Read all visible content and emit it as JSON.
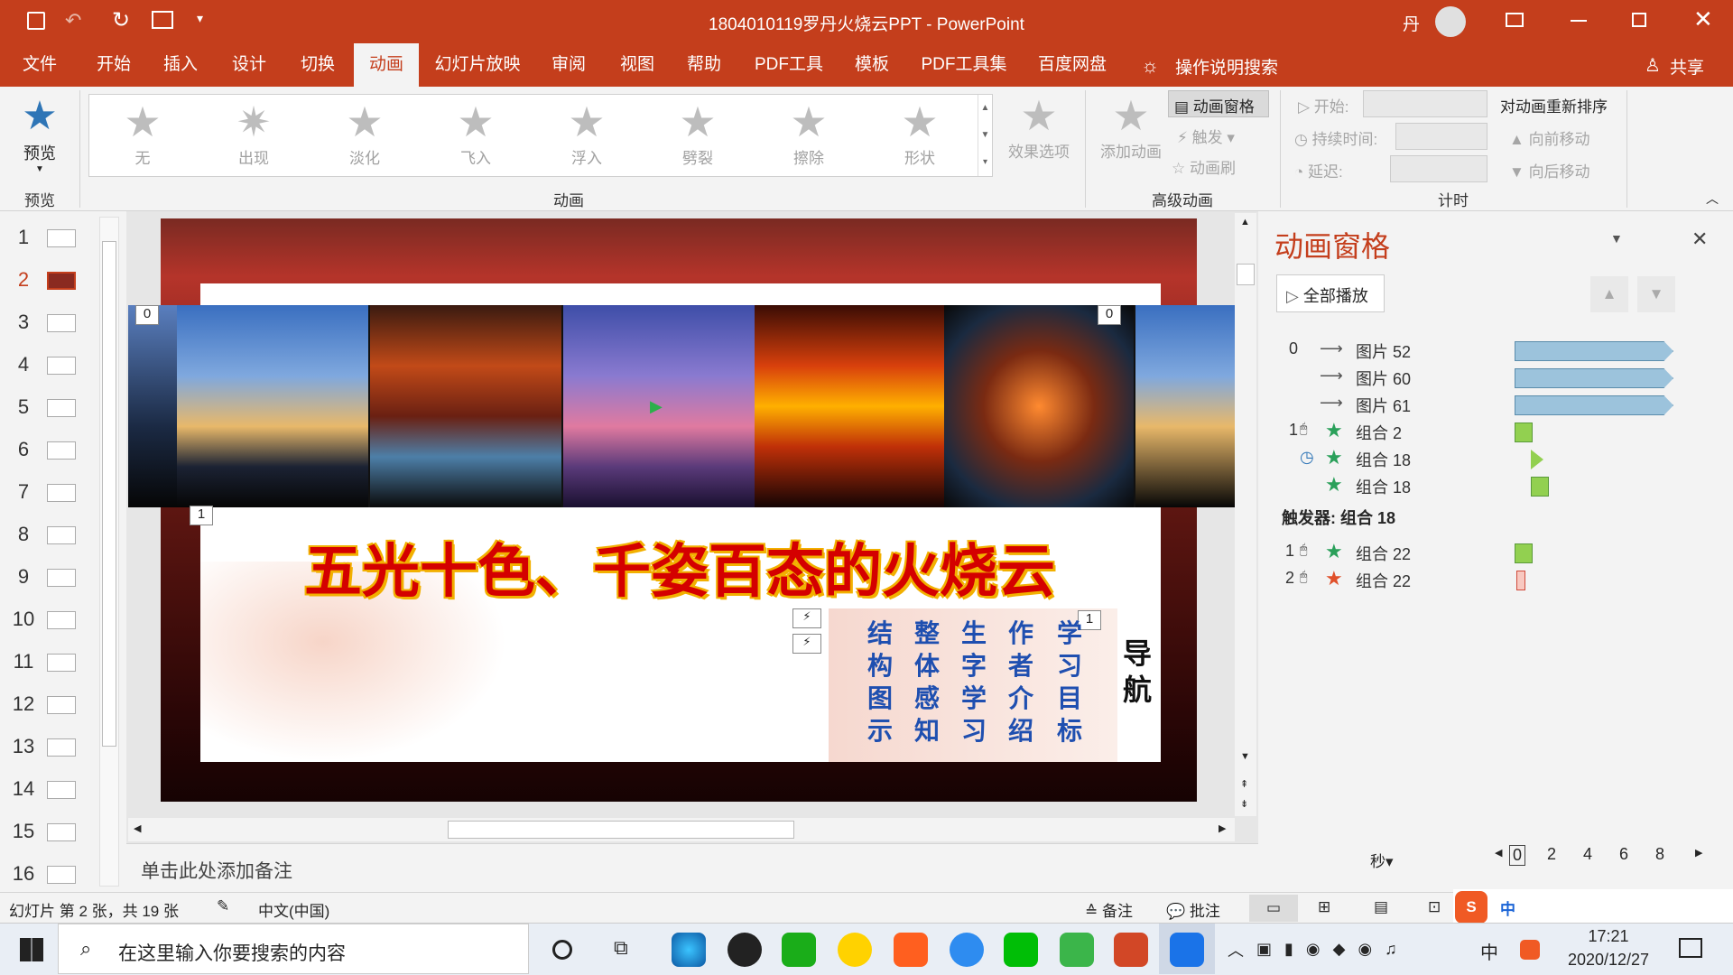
{
  "window": {
    "title": "1804010119罗丹火烧云PPT - PowerPoint",
    "user": "丹"
  },
  "tabs": [
    "文件",
    "开始",
    "插入",
    "设计",
    "切换",
    "动画",
    "幻灯片放映",
    "审阅",
    "视图",
    "帮助",
    "PDF工具",
    "模板",
    "PDF工具集",
    "百度网盘"
  ],
  "active_tab": "动画",
  "tellme": "操作说明搜索",
  "share": "共享",
  "ribbon": {
    "preview": {
      "label": "预览",
      "group": "预览"
    },
    "animations": [
      "无",
      "出现",
      "淡化",
      "飞入",
      "浮入",
      "劈裂",
      "擦除",
      "形状"
    ],
    "effect_options": "效果选项",
    "group_animation": "动画",
    "add_animation": "添加动画",
    "anim_pane_btn": "动画窗格",
    "trigger": "触发",
    "anim_painter": "动画刷",
    "group_advanced": "高级动画",
    "start_label": "开始:",
    "duration_label": "持续时间:",
    "delay_label": "延迟:",
    "reorder_title": "对动画重新排序",
    "move_earlier": "向前移动",
    "move_later": "向后移动",
    "group_timing": "计时"
  },
  "thumbs": [
    "1",
    "2",
    "3",
    "4",
    "5",
    "6",
    "7",
    "8",
    "9",
    "10",
    "11",
    "12",
    "13",
    "14",
    "15",
    "16"
  ],
  "active_slide": "2",
  "slide": {
    "title": "五光十色、千姿百态的火烧云",
    "tag0a": "0",
    "tag0b": "0",
    "tag1a": "1",
    "tag1b": "1",
    "nav": "导航",
    "nav_items": [
      "学习目标",
      "作者介绍",
      "生字学习",
      "整体感知",
      "结构图示"
    ]
  },
  "notes": "单击此处添加备注",
  "pane": {
    "title": "动画窗格",
    "play_all": "全部播放",
    "items": [
      {
        "num": "0",
        "name": "图片 52"
      },
      {
        "num": "",
        "name": "图片 60"
      },
      {
        "num": "",
        "name": "图片 61"
      },
      {
        "num": "1",
        "name": "组合 2"
      },
      {
        "num": "",
        "name": "组合 18"
      },
      {
        "num": "",
        "name": "组合 18"
      }
    ],
    "trigger_label": "触发器: 组合 18",
    "trigger_items": [
      {
        "num": "1",
        "name": "组合 22"
      },
      {
        "num": "2",
        "name": "组合 22"
      }
    ],
    "seconds": "秒",
    "scale": [
      "0",
      "2",
      "4",
      "6",
      "8"
    ]
  },
  "status": {
    "slide_info": "幻灯片 第 2 张，共 19 张",
    "lang": "中文(中国)",
    "notes": "备注",
    "comments": "批注"
  },
  "taskbar": {
    "search_placeholder": "在这里输入你要搜索的内容",
    "time": "17:21",
    "date": "2020/12/27",
    "ime": "中"
  },
  "colors": {
    "accent": "#c43e1c",
    "ribbon_bg": "#f3f3f3",
    "anim_bar": "#9cc3dc",
    "green": "#92d050",
    "title_text": "#d40000"
  }
}
